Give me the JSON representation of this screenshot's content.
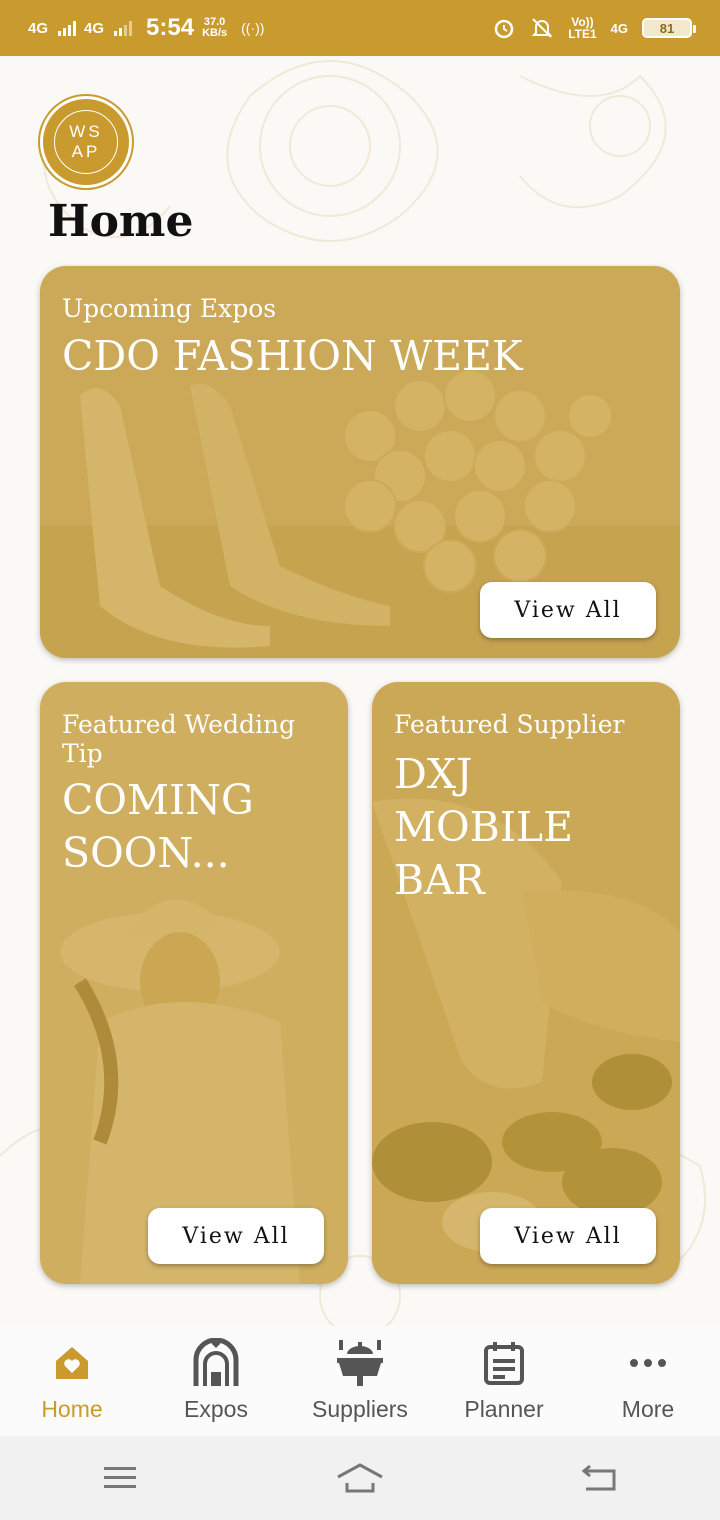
{
  "status_bar": {
    "signal1": "4G",
    "signal2": "4G",
    "time": "5:54",
    "speed_value": "37.0",
    "speed_unit": "KB/s",
    "volte_top": "Vo))",
    "volte_bottom": "LTE1",
    "net_right": "4G",
    "battery": "81"
  },
  "logo": {
    "line1": "WS",
    "line2": "AP"
  },
  "page": {
    "title": "Home"
  },
  "cards": {
    "expo": {
      "label": "Upcoming Expos",
      "title": "CDO FASHION WEEK",
      "button": "View All"
    },
    "tip": {
      "label": "Featured Wedding Tip",
      "title": "COMING SOON...",
      "button": "View All"
    },
    "supplier": {
      "label": "Featured Supplier",
      "title": "DXJ MOBILE BAR",
      "button": "View All"
    }
  },
  "nav": {
    "items": [
      {
        "label": "Home",
        "icon": "home-heart-icon"
      },
      {
        "label": "Expos",
        "icon": "wedding-arch-icon"
      },
      {
        "label": "Suppliers",
        "icon": "catering-table-icon"
      },
      {
        "label": "Planner",
        "icon": "calendar-planner-icon"
      },
      {
        "label": "More",
        "icon": "more-dots-icon"
      }
    ],
    "active_index": 0
  },
  "colors": {
    "accent": "#c99a2e",
    "overlay": "#c49628",
    "nav_text": "#555555"
  }
}
